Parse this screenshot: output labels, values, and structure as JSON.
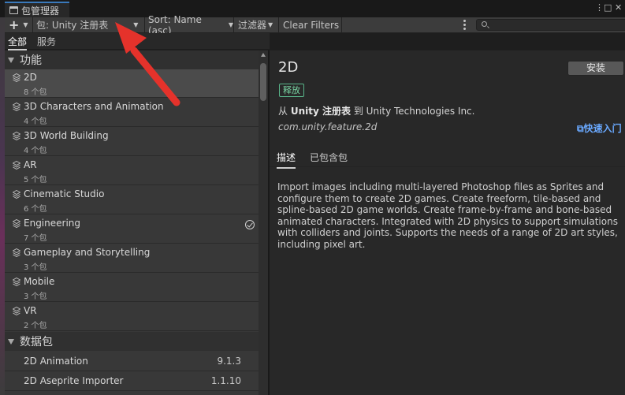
{
  "window": {
    "title": "包管理器",
    "controls": {
      "menu": "⋮",
      "maximize": "□",
      "close": "✕"
    }
  },
  "toolbar": {
    "add": "+",
    "registry_filter": "包: Unity 注册表",
    "sort": "Sort: Name (asc)",
    "filters": "过滤器",
    "clear_filters": "Clear Filters",
    "search_placeholder": ""
  },
  "scope_tabs": [
    {
      "label": "全部",
      "active": true
    },
    {
      "label": "服务",
      "active": false
    }
  ],
  "sections": {
    "features": "功能",
    "packages": "数据包"
  },
  "features": [
    {
      "name": "2D",
      "count": "8 个包",
      "selected": true,
      "installed": false
    },
    {
      "name": "3D Characters and Animation",
      "count": "4 个包",
      "selected": false,
      "installed": false
    },
    {
      "name": "3D World Building",
      "count": "4 个包",
      "selected": false,
      "installed": false
    },
    {
      "name": "AR",
      "count": "5 个包",
      "selected": false,
      "installed": false
    },
    {
      "name": "Cinematic Studio",
      "count": "6 个包",
      "selected": false,
      "installed": false
    },
    {
      "name": "Engineering",
      "count": "7 个包",
      "selected": false,
      "installed": true
    },
    {
      "name": "Gameplay and Storytelling",
      "count": "3 个包",
      "selected": false,
      "installed": false
    },
    {
      "name": "Mobile",
      "count": "3 个包",
      "selected": false,
      "installed": false
    },
    {
      "name": "VR",
      "count": "2 个包",
      "selected": false,
      "installed": false
    }
  ],
  "packages": [
    {
      "name": "2D Animation",
      "version": "9.1.3"
    },
    {
      "name": "2D Aseprite Importer",
      "version": "1.1.10"
    }
  ],
  "detail": {
    "title": "2D",
    "install_label": "安装",
    "release_badge": "释放",
    "registry_prefix": "从",
    "registry_name": "Unity 注册表",
    "registry_mid": "到",
    "publisher": "Unity Technologies Inc.",
    "package_id": "com.unity.feature.2d",
    "quick_link": "快速入门",
    "tabs": [
      {
        "label": "描述",
        "active": true
      },
      {
        "label": "已包含包",
        "active": false
      }
    ],
    "description": "Import images including multi-layered Photoshop files as Sprites and configure them to create 2D games. Create freeform, tile-based and spline-based 2D game worlds. Create frame-by-frame and bone-based animated characters. Integrated with 2D physics to support simulations with colliders and joints. Supports the needs of a range of 2D art styles, including pixel art."
  },
  "colors": {
    "accent": "#3a79bb",
    "release_green": "#79d4a3",
    "link_blue": "#6aa9ff",
    "annotation_red": "#e5322b"
  }
}
